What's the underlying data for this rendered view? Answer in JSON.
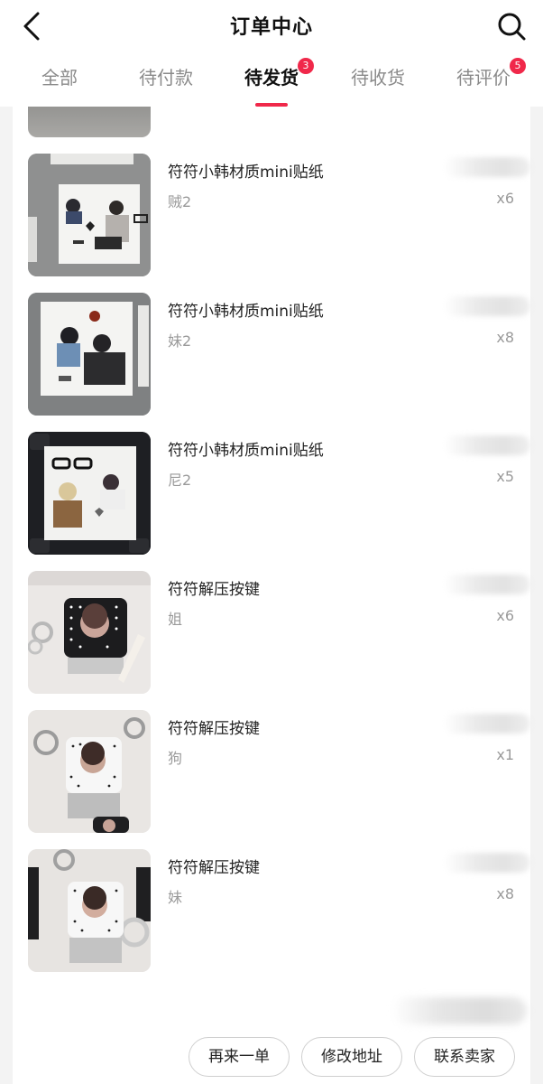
{
  "header": {
    "title": "订单中心",
    "back_icon": "chevron-left-icon",
    "search_icon": "search-icon"
  },
  "tabs": [
    {
      "label": "全部",
      "badge": "",
      "active": false
    },
    {
      "label": "待付款",
      "badge": "",
      "active": false
    },
    {
      "label": "待发货",
      "badge": "3",
      "active": true
    },
    {
      "label": "待收货",
      "badge": "",
      "active": false
    },
    {
      "label": "待评价",
      "badge": "5",
      "active": false
    }
  ],
  "items": [
    {
      "title": "符符小韩材质mini贴纸",
      "spec": "贼2",
      "qty": "x6"
    },
    {
      "title": "符符小韩材质mini贴纸",
      "spec": "妹2",
      "qty": "x8"
    },
    {
      "title": "符符小韩材质mini贴纸",
      "spec": "尼2",
      "qty": "x5"
    },
    {
      "title": "符符解压按键",
      "spec": "姐",
      "qty": "x6"
    },
    {
      "title": "符符解压按键",
      "spec": "狗",
      "qty": "x1"
    },
    {
      "title": "符符解压按键",
      "spec": "妹",
      "qty": "x8"
    }
  ],
  "actions": {
    "reorder": "再来一单",
    "edit_address": "修改地址",
    "contact_seller": "联系卖家"
  },
  "colors": {
    "accent": "#f0284a",
    "muted": "#9a9a9a",
    "background": "#f3f3f3"
  }
}
